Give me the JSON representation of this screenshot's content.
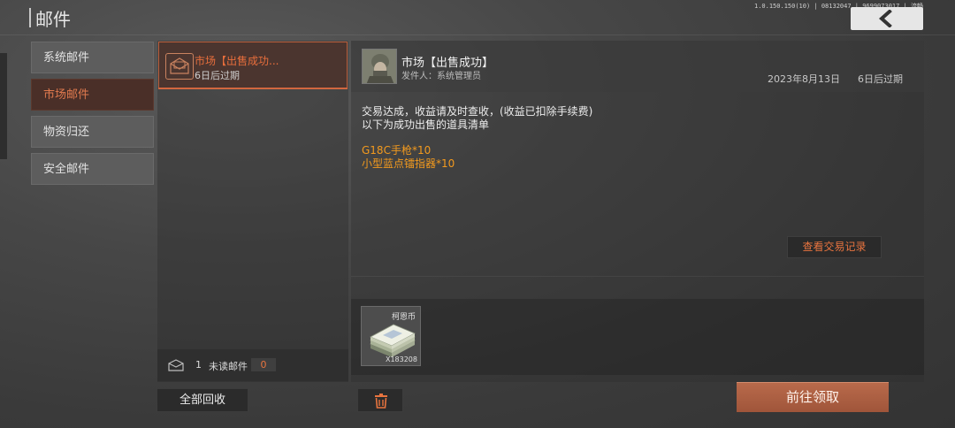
{
  "header": {
    "title": "邮件",
    "version": "1.0.150.150(10) | 08132047 | 9699073017 | 流畅"
  },
  "categories": [
    {
      "label": "系统邮件",
      "active": false
    },
    {
      "label": "市场邮件",
      "active": true
    },
    {
      "label": "物资归还",
      "active": false
    },
    {
      "label": "安全邮件",
      "active": false
    }
  ],
  "mail_list": {
    "items": [
      {
        "title": "市场【出售成功...",
        "expire": "6日后过期"
      }
    ],
    "unread_count": "1",
    "unread_label": "未读邮件",
    "unread_badge": "0",
    "collect_all_label": "全部回收"
  },
  "detail": {
    "title": "市场【出售成功】",
    "sender_prefix": "发件人：",
    "sender": "系统管理员",
    "date": "2023年8月13日",
    "expire": "6日后过期",
    "body_lines": [
      "交易达成，收益请及时查收，(收益已扣除手续费)",
      "以下为成功出售的道具清单"
    ],
    "item_lines": [
      "G18C手枪*10",
      "小型蓝点镭指器*10"
    ],
    "view_record_label": "查看交易记录",
    "attachment": {
      "name": "柯恩币",
      "quantity": "X183208"
    },
    "claim_label": "前往领取"
  },
  "colors": {
    "accent": "#e8743f",
    "item_highlight": "#f39a1e",
    "claim_button": "#ad5f42"
  }
}
